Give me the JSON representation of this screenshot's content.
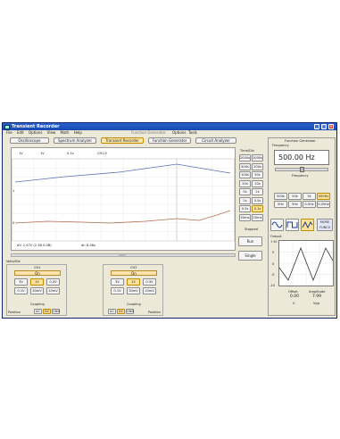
{
  "window": {
    "title": "Transient Recorder"
  },
  "menu": [
    "File",
    "Edit",
    "Options",
    "View",
    "Math",
    "Help"
  ],
  "menu_secondary": {
    "label": "Function Generator",
    "items": [
      "Options",
      "Tools"
    ]
  },
  "modes": [
    "Oscilloscope",
    "Spectrum Analyzer",
    "Transient Recorder",
    "Function Generator",
    "Circuit Analyzer"
  ],
  "scope": {
    "top_labels": [
      "1V",
      "1V",
      "0.1s",
      "CH1/2"
    ],
    "marker_1": "1",
    "marker_2": "2",
    "readout_left": "dV: 2.47V  (2.3B 0.0B)",
    "readout_right": "dt: 8.46s"
  },
  "time_div": {
    "title": "Time/Div",
    "options": [
      "2000s",
      "1000s",
      "500s",
      "200s",
      "100s",
      "50s",
      "20s",
      "10s",
      "5s",
      "2s",
      "1s",
      "0.5s",
      "0.2s",
      "0.1s",
      "50ms",
      "20ms"
    ],
    "selected": "0.1s"
  },
  "status": "Stopped",
  "run_label": "Run",
  "single_label": "Single",
  "volts_div_label": "Volts/Div",
  "ch1": {
    "name": "CH1",
    "on": "On",
    "volts": [
      "3V",
      "1V",
      "0.3V",
      "0.1V",
      "30mV",
      "10mV"
    ],
    "selected_volts": "1V",
    "coupling_label": "Coupling",
    "coupling": [
      "AC",
      "DC",
      "GND"
    ],
    "selected_coupling": "DC",
    "position_label": "Position"
  },
  "ch2": {
    "name": "CH2",
    "on": "On",
    "volts": [
      "3V",
      "1V",
      "0.3V",
      "0.1V",
      "30mV",
      "10mV"
    ],
    "selected_volts": "1V",
    "coupling_label": "Coupling",
    "coupling": [
      "AC",
      "DC",
      "GND"
    ],
    "selected_coupling": "DC",
    "position_label": "Position"
  },
  "fg": {
    "title": "Function Generator",
    "frequency_label": "Frequency",
    "frequency_value": "500.00 Hz",
    "frequency_caption": "Frequency",
    "freq_buttons": [
      "500k",
      "50k",
      "5k",
      "500Hz",
      "5Hz",
      "5Hz",
      "0.5Hz",
      "0.05Hz"
    ],
    "selected_freq": "500Hz",
    "waveforms": [
      "sine-icon",
      "square-icon",
      "triangle-icon"
    ],
    "selected_wave": "triangle-icon",
    "more_label": "MORE FUNCS",
    "output_label": "Output",
    "y_ticks": [
      "+10",
      "5",
      "0",
      "-5",
      "-10"
    ],
    "offset_label": "Offset",
    "offset_value": "0.00",
    "offset_unit": "V",
    "amplitude_label": "Amplitude",
    "amplitude_value": "7.99",
    "amplitude_unit": "Vpp"
  }
}
